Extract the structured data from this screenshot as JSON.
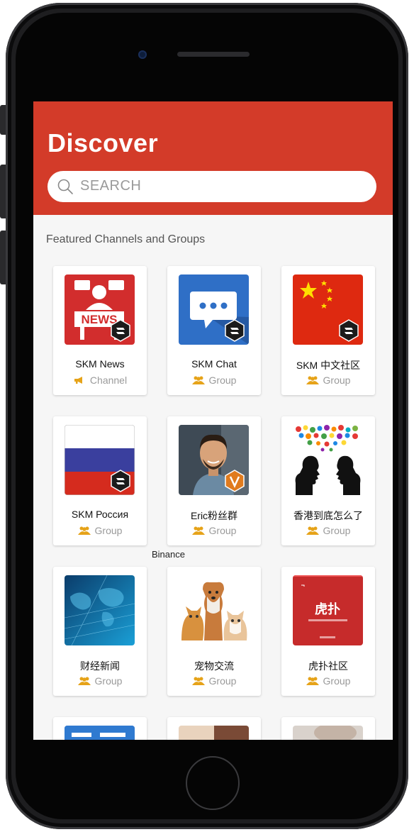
{
  "header": {
    "title": "Discover"
  },
  "search": {
    "placeholder": "SEARCH"
  },
  "section": {
    "title": "Featured Channels and Groups"
  },
  "cards": [
    {
      "name": "SKM News",
      "type": "Channel",
      "thumb": "news-icon",
      "badge": "skm-logo"
    },
    {
      "name": "SKM Chat",
      "type": "Group",
      "thumb": "chat-bubble-icon",
      "badge": "skm-logo"
    },
    {
      "name": "SKM 中文社区",
      "type": "Group",
      "thumb": "china-flag",
      "badge": "skm-logo"
    },
    {
      "name": "SKM Россия",
      "type": "Group",
      "thumb": "russia-flag",
      "badge": "skm-logo"
    },
    {
      "name": "Eric粉丝群",
      "type": "Group",
      "thumb": "person-photo",
      "badge": "verified-v"
    },
    {
      "name": "香港到底怎么了",
      "type": "Group",
      "thumb": "speech-silhouettes",
      "badge": ""
    },
    {
      "name": "财经新闻",
      "type": "Group",
      "thumb": "world-map-blue",
      "badge": ""
    },
    {
      "name": "宠物交流",
      "type": "Group",
      "thumb": "pets-photo",
      "badge": ""
    },
    {
      "name": "虎扑社区",
      "type": "Group",
      "thumb": "hupu-logo",
      "badge": ""
    }
  ],
  "floating_label": "Binance",
  "colors": {
    "header": "#d33b29",
    "group_icon": "#e6a319",
    "channel_icon": "#e6a319"
  }
}
